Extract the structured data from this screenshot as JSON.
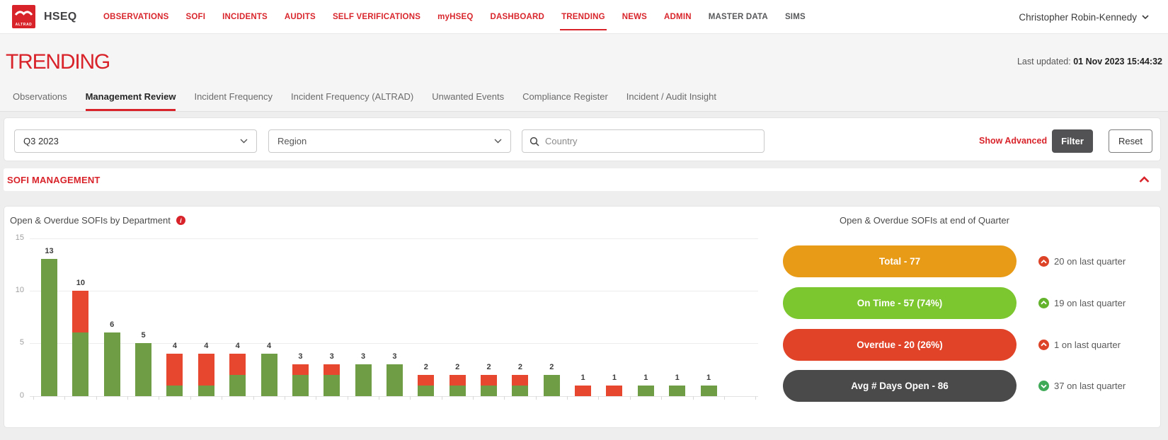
{
  "navbar": {
    "brand": "HSEQ",
    "logo_text": "ALTRAD",
    "items": [
      {
        "label": "OBSERVATIONS",
        "active": false,
        "muted": false
      },
      {
        "label": "SOFI",
        "active": false,
        "muted": false
      },
      {
        "label": "INCIDENTS",
        "active": false,
        "muted": false
      },
      {
        "label": "AUDITS",
        "active": false,
        "muted": false
      },
      {
        "label": "SELF VERIFICATIONS",
        "active": false,
        "muted": false
      },
      {
        "label": "myHSEQ",
        "active": false,
        "muted": false
      },
      {
        "label": "DASHBOARD",
        "active": false,
        "muted": false
      },
      {
        "label": "TRENDING",
        "active": true,
        "muted": false
      },
      {
        "label": "NEWS",
        "active": false,
        "muted": false
      },
      {
        "label": "ADMIN",
        "active": false,
        "muted": false
      },
      {
        "label": "MASTER DATA",
        "active": false,
        "muted": true
      },
      {
        "label": "SIMS",
        "active": false,
        "muted": true
      }
    ],
    "user": "Christopher Robin-Kennedy",
    "user_chevron_icon": "chevron-down"
  },
  "header": {
    "title": "TRENDING",
    "last_updated_label": "Last updated:",
    "last_updated_value": "01 Nov 2023 15:44:32",
    "tabs": [
      {
        "label": "Observations",
        "active": false
      },
      {
        "label": "Management Review",
        "active": true
      },
      {
        "label": "Incident Frequency",
        "active": false
      },
      {
        "label": "Incident Frequency (ALTRAD)",
        "active": false
      },
      {
        "label": "Unwanted Events",
        "active": false
      },
      {
        "label": "Compliance Register",
        "active": false
      },
      {
        "label": "Incident / Audit Insight",
        "active": false
      }
    ]
  },
  "filters": {
    "quarter": "Q3 2023",
    "region_placeholder": "Region",
    "country_placeholder": "Country",
    "show_advanced": "Show Advanced",
    "filter_label": "Filter",
    "reset_label": "Reset"
  },
  "section": {
    "title": "SOFI MANAGEMENT",
    "collapse_icon": "chevron-up"
  },
  "chart_data": {
    "type": "bar",
    "stacked": true,
    "title": "Open & Overdue SOFIs by Department",
    "ylim": [
      0,
      15
    ],
    "yticks": [
      0,
      5,
      10,
      15
    ],
    "grid": true,
    "x_labels_visible": false,
    "series": [
      {
        "name": "On Time",
        "color": "#6f9d45",
        "values": [
          13,
          6,
          6,
          5,
          1,
          1,
          2,
          4,
          2,
          2,
          3,
          3,
          1,
          1,
          1,
          1,
          2,
          0,
          0,
          1,
          1,
          1
        ]
      },
      {
        "name": "Overdue",
        "color": "#e7472e",
        "values": [
          0,
          4,
          0,
          0,
          3,
          3,
          2,
          0,
          1,
          1,
          0,
          0,
          1,
          1,
          1,
          1,
          0,
          1,
          1,
          0,
          0,
          0
        ]
      }
    ],
    "totals": [
      13,
      10,
      6,
      5,
      4,
      4,
      4,
      4,
      3,
      3,
      3,
      3,
      2,
      2,
      2,
      2,
      2,
      1,
      1,
      1,
      1,
      1
    ]
  },
  "summary": {
    "title": "Open & Overdue SOFIs at end of Quarter",
    "pills": [
      {
        "label": "Total - 77",
        "color": "#e89b17",
        "delta": "20 on last quarter",
        "direction": "up",
        "delta_color": "#dd4327"
      },
      {
        "label": "On Time - 57 (74%)",
        "color": "#7cc62f",
        "delta": "19 on last quarter",
        "direction": "up",
        "delta_color": "#64b32c"
      },
      {
        "label": "Overdue - 20 (26%)",
        "color": "#e04328",
        "delta": "1 on last quarter",
        "direction": "up",
        "delta_color": "#dd4327"
      },
      {
        "label": "Avg # Days Open - 86",
        "color": "#4a4a4a",
        "delta": "37 on last quarter",
        "direction": "down",
        "delta_color": "#3faa58"
      }
    ]
  }
}
